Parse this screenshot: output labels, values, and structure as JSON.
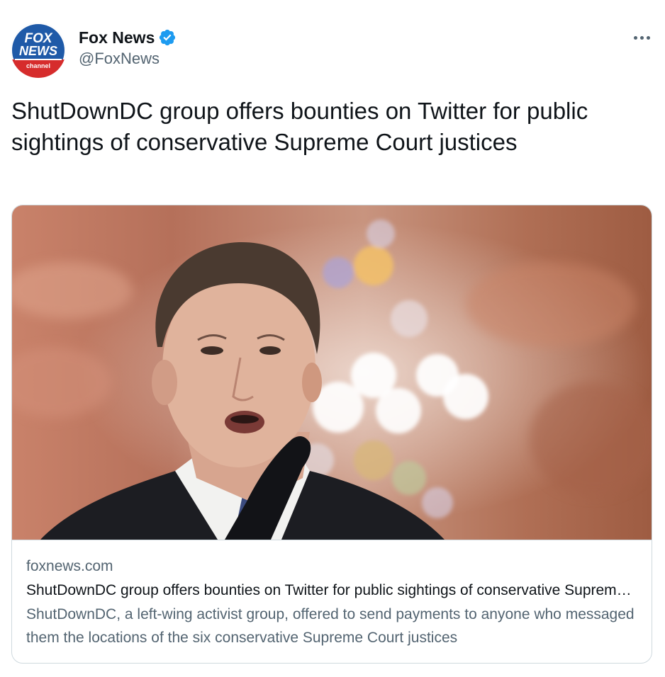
{
  "author": {
    "display_name": "Fox News",
    "handle": "@FoxNews",
    "avatar_icon": "fox-news-channel-logo",
    "verified_icon": "verified-badge-icon",
    "logo_text": {
      "top": "FOX",
      "middle": "NEWS",
      "bottom": "channel"
    }
  },
  "tweet": {
    "text": "ShutDownDC group offers bounties on Twitter for public sightings of conservative Supreme Court justices"
  },
  "menu_icon": "more-horizontal-icon",
  "card": {
    "domain": "foxnews.com",
    "title": "ShutDownDC group offers bounties on Twitter for public sightings of conservative Supreme Court justices",
    "description": "ShutDownDC, a left-wing activist group, offered to send payments to anyone who messaged them the locations of the six conservative Supreme Court justices"
  },
  "colors": {
    "verified": "#1d9bf0",
    "secondary_text": "#536471",
    "primary_text": "#0f1419",
    "border": "#cfd9de"
  }
}
